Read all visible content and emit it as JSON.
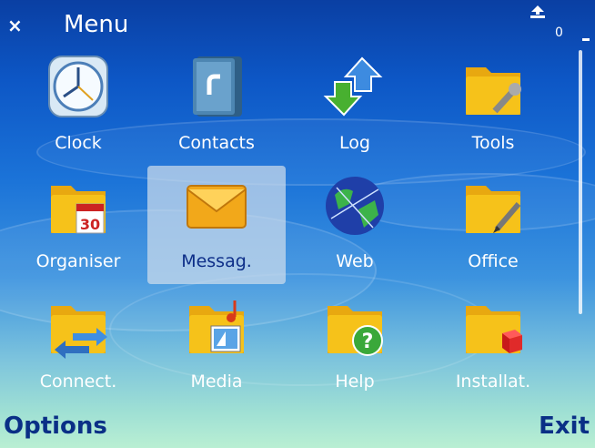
{
  "window": {
    "title": "Menu"
  },
  "status": {
    "indicator_number": "0"
  },
  "menu_items": [
    {
      "label": "Clock",
      "icon": "clock-icon"
    },
    {
      "label": "Contacts",
      "icon": "contacts-book-icon"
    },
    {
      "label": "Log",
      "icon": "log-arrows-icon"
    },
    {
      "label": "Tools",
      "icon": "tools-folder-icon"
    },
    {
      "label": "Organiser",
      "icon": "organiser-calendar-folder-icon",
      "calendar_day": "30"
    },
    {
      "label": "Messag.",
      "icon": "envelope-icon"
    },
    {
      "label": "Web",
      "icon": "globe-icon"
    },
    {
      "label": "Office",
      "icon": "office-folder-icon"
    },
    {
      "label": "Connect.",
      "icon": "connectivity-folder-icon"
    },
    {
      "label": "Media",
      "icon": "media-folder-icon"
    },
    {
      "label": "Help",
      "icon": "help-folder-icon"
    },
    {
      "label": "Installat.",
      "icon": "installations-folder-icon"
    }
  ],
  "selected_item": "Messag.",
  "softkeys": {
    "left": "Options",
    "right": "Exit"
  },
  "colors": {
    "softkey_text": "#0a2f86",
    "selection": "#cddceb",
    "folder_yellow": "#f6c21a"
  }
}
